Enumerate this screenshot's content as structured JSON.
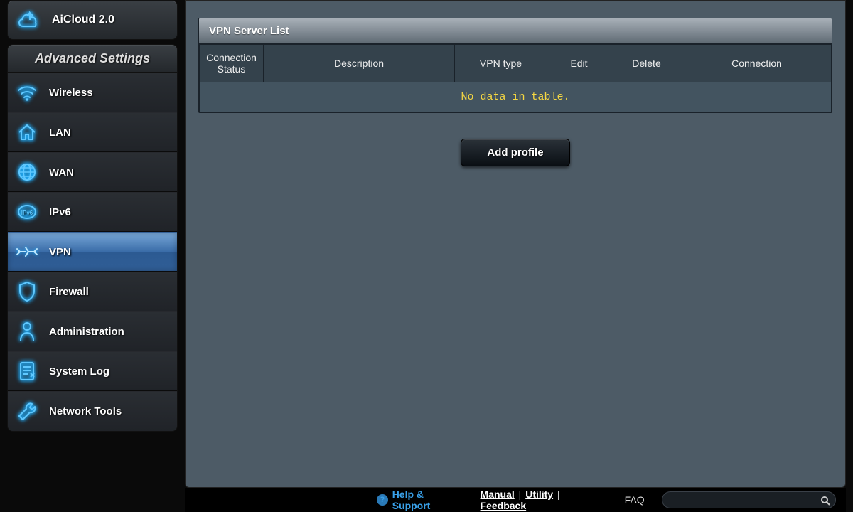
{
  "sidebar": {
    "top_item": {
      "label": "AiCloud 2.0"
    },
    "section_header": "Advanced Settings",
    "items": [
      {
        "label": "Wireless"
      },
      {
        "label": "LAN"
      },
      {
        "label": "WAN"
      },
      {
        "label": "IPv6"
      },
      {
        "label": "VPN"
      },
      {
        "label": "Firewall"
      },
      {
        "label": "Administration"
      },
      {
        "label": "System Log"
      },
      {
        "label": "Network Tools"
      }
    ]
  },
  "main": {
    "table_title": "VPN Server List",
    "columns": {
      "conn_status": "Connection Status",
      "description": "Description",
      "vpn_type": "VPN type",
      "edit": "Edit",
      "delete": "Delete",
      "connection": "Connection"
    },
    "empty_text": "No data in table.",
    "add_profile_label": "Add profile"
  },
  "footer": {
    "help": "Help & Support",
    "manual": "Manual",
    "utility": "Utility",
    "feedback": "Feedback",
    "faq": "FAQ"
  }
}
